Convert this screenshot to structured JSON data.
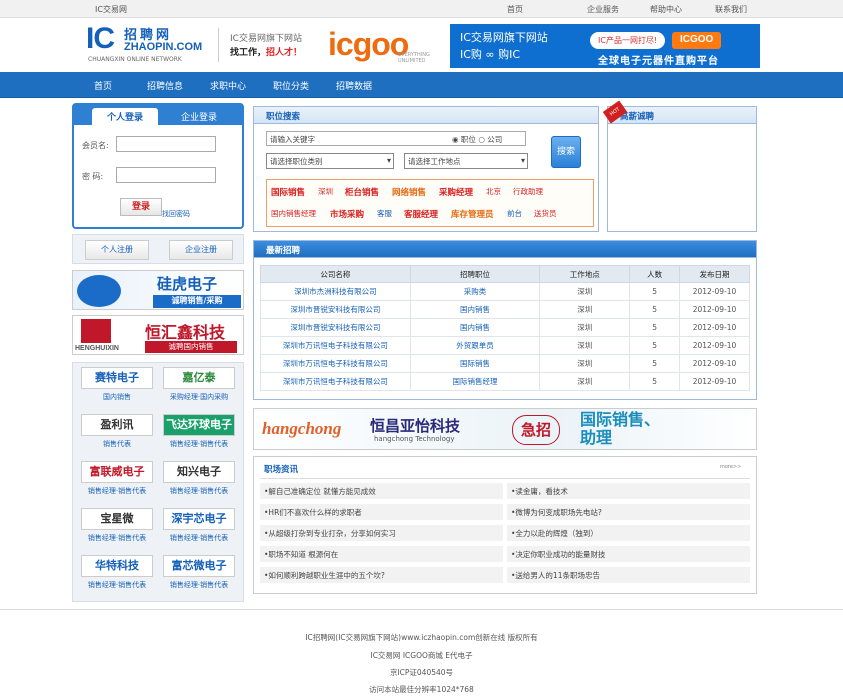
{
  "topbar": {
    "site": "IC交易网",
    "links": [
      "首页",
      "企业服务",
      "帮助中心",
      "联系我们"
    ]
  },
  "header": {
    "logo_ic": "IC",
    "logo_cn": "招聘网",
    "logo_en": "ZHAOPIN.COM",
    "logo_sub": "CHUANGXIN ONLINE NETWORK",
    "slogan1": "IC交易网旗下网站",
    "slogan2_a": "找工作，",
    "slogan2_b": "招人才！",
    "iggoo": {
      "wordmark": "icgoo",
      "tag": "EVERYTHING UNLIMITED",
      "t1": "IC交易网旗下网站",
      "t2": "IC购 ∞ 购IC",
      "pill": "IC产品一网打尽!",
      "pill2": "ICGOO",
      "t3": "全球电子元器件直购平台"
    }
  },
  "nav": [
    "首页",
    "招聘信息",
    "求职中心",
    "职位分类",
    "招聘数据"
  ],
  "login": {
    "tab_personal": "个人登录",
    "tab_company": "企业登录",
    "user_label": "会员名:",
    "pass_label": "密  码:",
    "button": "登录",
    "forgot": "找回密码"
  },
  "register": {
    "personal": "个人注册",
    "company": "企业注册"
  },
  "banners": {
    "b1": {
      "name": "硅虎电子",
      "sub": "诚聘销售/采购"
    },
    "b2": {
      "en": "HENGHUIXIN",
      "name": "恒汇鑫科技",
      "sub": "诚聘国内销售"
    }
  },
  "companies": [
    {
      "name": "赛特电子",
      "sub": "国内销售",
      "color": "#1560b8"
    },
    {
      "name": "嘉亿泰",
      "sub": "采购经理·国内采购",
      "color": "#2a8a3a"
    },
    {
      "name": "盈利讯",
      "sub": "销售代表",
      "color": "#333333"
    },
    {
      "name": "飞达环球电子",
      "sub": "销售经理·销售代表",
      "color": "#ffffff"
    },
    {
      "name": "富联威电子",
      "sub": "销售经理·销售代表",
      "color": "#c0182a"
    },
    {
      "name": "知兴电子",
      "sub": "销售经理·销售代表",
      "color": "#333333"
    },
    {
      "name": "宝星微",
      "sub": "销售经理·销售代表",
      "color": "#333333"
    },
    {
      "name": "深宇芯电子",
      "sub": "销售经理·销售代表",
      "color": "#1560b8"
    },
    {
      "name": "华特科技",
      "sub": "销售经理·销售代表",
      "color": "#1560b8"
    },
    {
      "name": "富芯微电子",
      "sub": "销售经理·销售代表",
      "color": "#1560b8"
    }
  ],
  "search": {
    "title": "职位搜索",
    "keyword_placeholder": "请输入关键字",
    "radio_job": "◉ 职位",
    "radio_company": "○ 公司",
    "category": "请选择职位类别",
    "location": "请选择工作地点",
    "button": "搜索",
    "hot_row1": [
      {
        "t": "国际销售",
        "c": "r"
      },
      {
        "t": "深圳",
        "c": "s"
      },
      {
        "t": "柜台销售",
        "c": "r"
      },
      {
        "t": "网络销售",
        "c": "o"
      },
      {
        "t": "采购经理",
        "c": "r"
      },
      {
        "t": "北京",
        "c": "s"
      },
      {
        "t": "行政助理",
        "c": "s"
      }
    ],
    "hot_row2": [
      {
        "t": "国内销售经理",
        "c": "s"
      },
      {
        "t": "市场采购",
        "c": "r"
      },
      {
        "t": "客服",
        "c": "b"
      },
      {
        "t": "客服经理",
        "c": "r"
      },
      {
        "t": "库存管理员",
        "c": "o"
      },
      {
        "t": "前台",
        "c": "b"
      },
      {
        "t": "送货员",
        "c": "s"
      }
    ]
  },
  "recruit": {
    "badge": "HOT",
    "title": "高薪诚聘"
  },
  "jobs": {
    "title": "最新招聘",
    "headers": [
      "公司名称",
      "招聘职位",
      "工作地点",
      "人数",
      "发布日期"
    ],
    "rows": [
      [
        "深圳市杰洲科技有限公司",
        "采购类",
        "深圳",
        "5",
        "2012-09-10"
      ],
      [
        "深圳市晋锐安科技有限公司",
        "国内销售",
        "深圳",
        "5",
        "2012-09-10"
      ],
      [
        "深圳市晋锐安科技有限公司",
        "国内销售",
        "深圳",
        "5",
        "2012-09-10"
      ],
      [
        "深圳市万讯恒电子科技有限公司",
        "外贸跟单员",
        "深圳",
        "5",
        "2012-09-10"
      ],
      [
        "深圳市万讯恒电子科技有限公司",
        "国际销售",
        "深圳",
        "5",
        "2012-09-10"
      ],
      [
        "深圳市万讯恒电子科技有限公司",
        "国际销售经理",
        "深圳",
        "5",
        "2012-09-10"
      ]
    ]
  },
  "ad": {
    "hc": "hangchong",
    "name": "恒昌亚怡科技",
    "en": "hangchong Technology",
    "urgent": "急招",
    "role1": "国际销售、",
    "role2": "助理"
  },
  "news": {
    "title": "职场资讯",
    "more": "more>>",
    "left": [
      "•解自己准确定位 就懂方能见成效",
      "•HR们不喜欢什么样的求职者",
      "•从超级打杂到专业打杂，分享如何实习",
      "•职场不知道 根源何在",
      "•如何顺利跨越职业生涯中的五个坎?"
    ],
    "right": [
      "•读金庸，看技术",
      "•微博为何变成职场先电站?",
      "•全力以赴的辉煌（独到）",
      "•决定你职业成功的能量财技",
      "•送给男人的11条职场忠告"
    ]
  },
  "footer": {
    "line1": "IC招聘网(IC交易网旗下网站)www.iczhaopin.com创新在线 版权所有",
    "line2": "IC交易网    ICGOO商城    E代电子",
    "line3": "京ICP证040540号",
    "line4": "访问本站最佳分辨率1024*768"
  }
}
